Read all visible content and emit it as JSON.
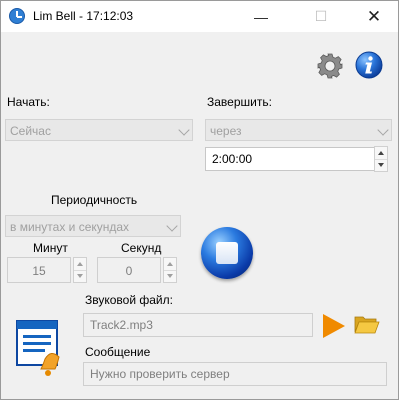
{
  "window": {
    "title": "Lim Bell - 17:12:03",
    "minimize": "—",
    "maximize": "☐",
    "close": "✕"
  },
  "start": {
    "label": "Начать:",
    "value": "Сейчас"
  },
  "finish": {
    "label": "Завершить:",
    "mode": "через",
    "time": "2:00:00"
  },
  "periodicity": {
    "label": "Периодичность",
    "mode": "в минутах и секундах",
    "minutes_label": "Минут",
    "seconds_label": "Секунд",
    "minutes": "15",
    "seconds": "0"
  },
  "sound": {
    "label": "Звуковой файл:",
    "file": "Track2.mp3"
  },
  "message": {
    "label": "Сообщение",
    "text": "Нужно проверить сервер"
  },
  "colors": {
    "play": "#f08a00",
    "stop": "#1a5fd0"
  }
}
